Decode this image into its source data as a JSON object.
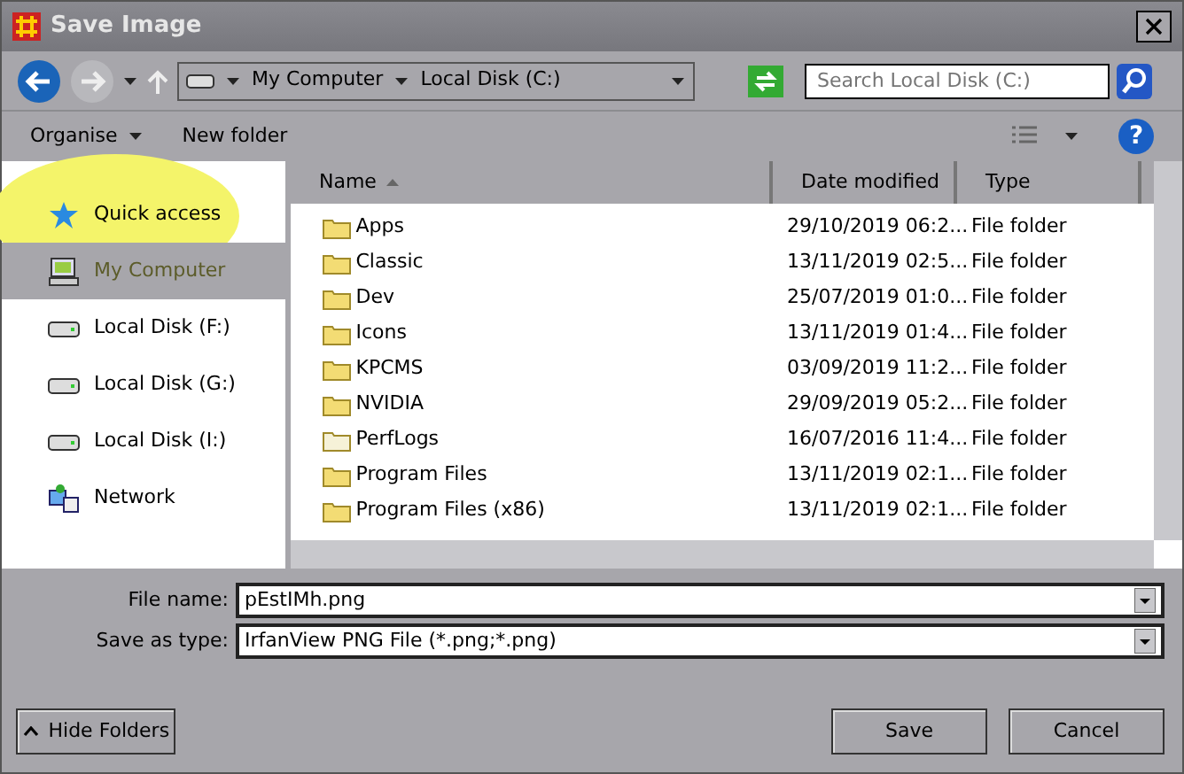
{
  "window": {
    "title": "Save Image"
  },
  "address": {
    "segments": [
      "My Computer",
      "Local Disk (C:)"
    ]
  },
  "search": {
    "placeholder": "Search Local Disk (C:)"
  },
  "commands": {
    "organise": "Organise",
    "new_folder": "New folder",
    "help": "?"
  },
  "sidebar": {
    "items": [
      {
        "label": "Quick access",
        "kind": "star",
        "selected": false,
        "highlighted": true
      },
      {
        "label": "My Computer",
        "kind": "computer",
        "selected": true,
        "highlighted": false
      },
      {
        "label": "Local Disk (F:)",
        "kind": "drive",
        "selected": false,
        "highlighted": false
      },
      {
        "label": "Local Disk (G:)",
        "kind": "drive",
        "selected": false,
        "highlighted": false
      },
      {
        "label": "Local Disk (I:)",
        "kind": "drive",
        "selected": false,
        "highlighted": false
      },
      {
        "label": "Network",
        "kind": "network",
        "selected": false,
        "highlighted": false
      }
    ]
  },
  "table": {
    "columns": [
      {
        "label": "Name",
        "sorted": true
      },
      {
        "label": "Date modified",
        "sorted": false
      },
      {
        "label": "Type",
        "sorted": false
      }
    ],
    "rows": [
      {
        "name": "Apps",
        "date": "29/10/2019 06:2...",
        "type": "File folder",
        "hidden": false
      },
      {
        "name": "Classic",
        "date": "13/11/2019 02:5...",
        "type": "File folder",
        "hidden": false
      },
      {
        "name": "Dev",
        "date": "25/07/2019 01:0...",
        "type": "File folder",
        "hidden": false
      },
      {
        "name": "Icons",
        "date": "13/11/2019 01:4...",
        "type": "File folder",
        "hidden": false
      },
      {
        "name": "KPCMS",
        "date": "03/09/2019 11:2...",
        "type": "File folder",
        "hidden": false
      },
      {
        "name": "NVIDIA",
        "date": "29/09/2019 05:2...",
        "type": "File folder",
        "hidden": false
      },
      {
        "name": "PerfLogs",
        "date": "16/07/2016 11:4...",
        "type": "File folder",
        "hidden": true
      },
      {
        "name": "Program Files",
        "date": "13/11/2019 02:1...",
        "type": "File folder",
        "hidden": false
      },
      {
        "name": "Program Files (x86)",
        "date": "13/11/2019 02:1...",
        "type": "File folder",
        "hidden": false
      }
    ]
  },
  "file_name": {
    "label": "File name:",
    "value": "pEstIMh.png"
  },
  "save_as_type": {
    "label": "Save as type:",
    "value": "IrfanView PNG File (*.png;*.png)"
  },
  "buttons": {
    "hide_folders": "Hide Folders",
    "save": "Save",
    "cancel": "Cancel"
  }
}
